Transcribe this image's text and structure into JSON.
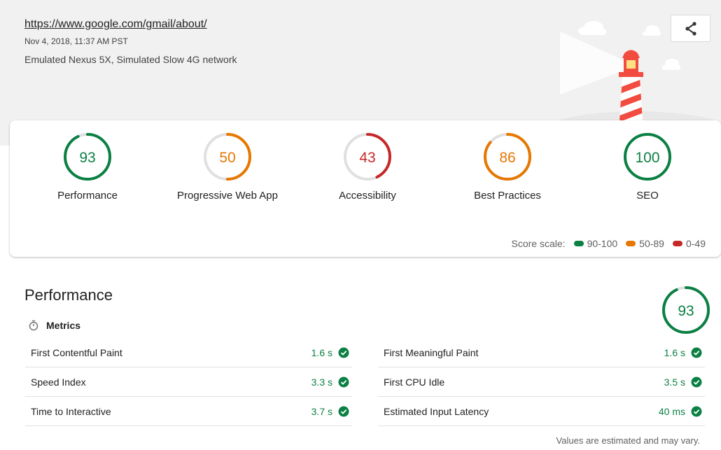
{
  "header": {
    "url": "https://www.google.com/gmail/about/",
    "date": "Nov 4, 2018, 11:37 AM PST",
    "environment": "Emulated Nexus 5X, Simulated Slow 4G network",
    "share_icon": "share-icon"
  },
  "colors": {
    "pass": "#0b8043",
    "average": "#e67700",
    "fail": "#c62828",
    "track": "#e0e0e0"
  },
  "scores": [
    {
      "value": "93",
      "label": "Performance",
      "fraction": 0.93,
      "status": "pass"
    },
    {
      "value": "50",
      "label": "Progressive Web App",
      "fraction": 0.5,
      "status": "average"
    },
    {
      "value": "43",
      "label": "Accessibility",
      "fraction": 0.43,
      "status": "fail"
    },
    {
      "value": "86",
      "label": "Best Practices",
      "fraction": 0.86,
      "status": "average"
    },
    {
      "value": "100",
      "label": "SEO",
      "fraction": 1.0,
      "status": "pass"
    }
  ],
  "scale": {
    "label": "Score scale:",
    "pass": "90-100",
    "average": "50-89",
    "fail": "0-49"
  },
  "performance": {
    "title": "Performance",
    "score": "93",
    "fraction": 0.93,
    "metrics_title": "Metrics",
    "metrics_left": [
      {
        "name": "First Contentful Paint",
        "value": "1.6 s"
      },
      {
        "name": "Speed Index",
        "value": "3.3 s"
      },
      {
        "name": "Time to Interactive",
        "value": "3.7 s"
      }
    ],
    "metrics_right": [
      {
        "name": "First Meaningful Paint",
        "value": "1.6 s"
      },
      {
        "name": "First CPU Idle",
        "value": "3.5 s"
      },
      {
        "name": "Estimated Input Latency",
        "value": "40 ms"
      }
    ],
    "note": "Values are estimated and may vary."
  }
}
